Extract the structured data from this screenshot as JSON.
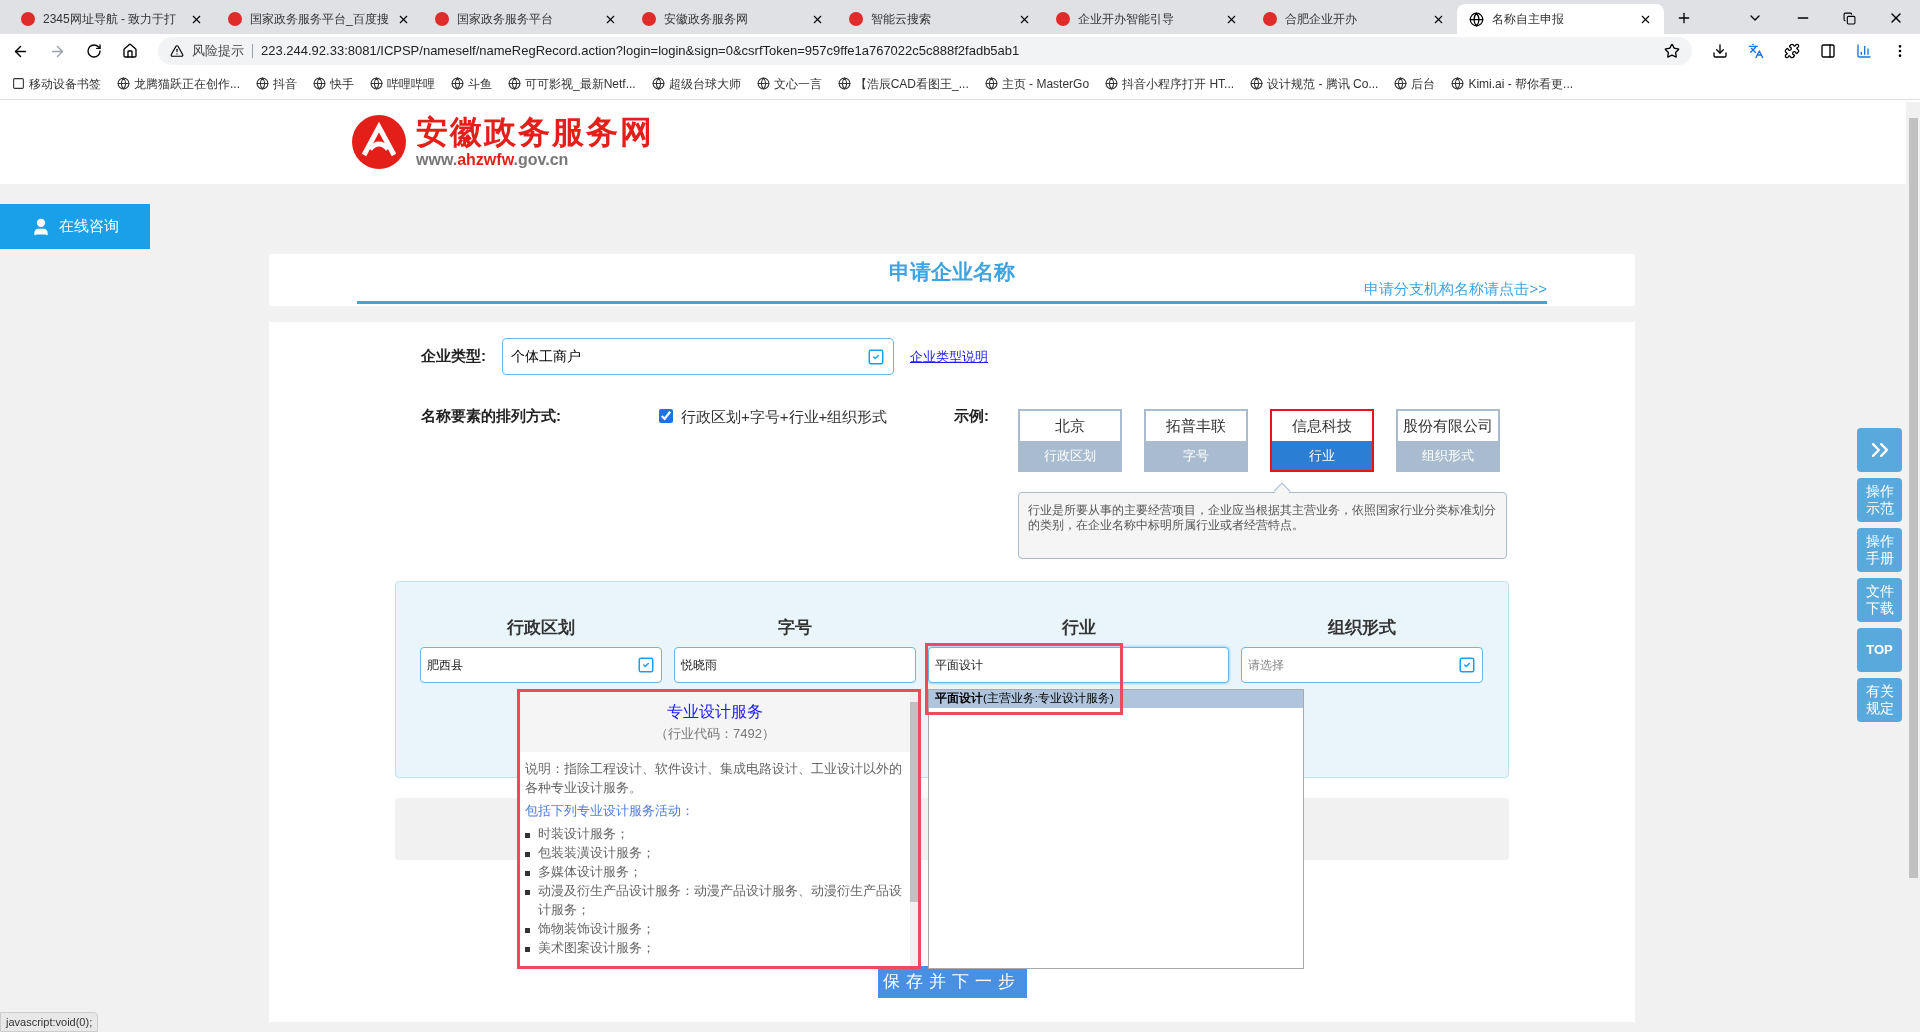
{
  "browser": {
    "tabs": [
      {
        "title": "2345网址导航 - 致力于打",
        "selected": false
      },
      {
        "title": "国家政务服务平台_百度搜",
        "selected": false
      },
      {
        "title": "国家政务服务平台",
        "selected": false
      },
      {
        "title": "安徽政务服务网",
        "selected": false
      },
      {
        "title": "智能云搜索",
        "selected": false
      },
      {
        "title": "企业开办智能引导",
        "selected": false
      },
      {
        "title": "合肥企业开办",
        "selected": false
      },
      {
        "title": "名称自主申报",
        "selected": true
      }
    ],
    "address": {
      "warning": "风险提示",
      "url": "223.244.92.33:8081/ICPSP/nameself/nameRegRecord.action?login=login&sign=0&csrfToken=957c9ffe1a767022c5c888f2fadb5ab1"
    },
    "bookmarks": [
      {
        "label": "移动设备书签"
      },
      {
        "label": "龙腾猫跃正在创作..."
      },
      {
        "label": "抖音"
      },
      {
        "label": "快手"
      },
      {
        "label": "哔哩哔哩"
      },
      {
        "label": "斗鱼"
      },
      {
        "label": "可可影视_最新Netf..."
      },
      {
        "label": "超级台球大师"
      },
      {
        "label": "文心一言"
      },
      {
        "label": "【浩辰CAD看图王_..."
      },
      {
        "label": "主页 - MasterGo"
      },
      {
        "label": "抖音小程序打开 HT..."
      },
      {
        "label": "设计规范 - 腾讯 Co..."
      },
      {
        "label": "后台"
      },
      {
        "label": "Kimi.ai - 帮你看更..."
      }
    ]
  },
  "site": {
    "logo_title": "安徽政务服务网",
    "domain_parts": [
      "www.",
      "ahzwfw",
      ".gov.cn"
    ],
    "consult_button": "在线咨询",
    "side_buttons": [
      {
        "kind": "icon"
      },
      {
        "kind": "text",
        "label": "操作示范"
      },
      {
        "kind": "text",
        "label": "操作手册"
      },
      {
        "kind": "text",
        "label": "文件下载"
      },
      {
        "kind": "bold",
        "label": "TOP"
      },
      {
        "kind": "text",
        "label": "有关规定"
      }
    ]
  },
  "form": {
    "title": "申请企业名称",
    "branch_link": "申请分支机构名称请点击>>",
    "enterprise_type": {
      "label": "企业类型:",
      "value": "个体工商户",
      "help_link": "企业类型说明"
    },
    "arrangement": {
      "label": "名称要素的排列方式:",
      "checked": true,
      "option": "行政区划+字号+行业+组织形式"
    },
    "example": {
      "label": "示例:",
      "items": [
        {
          "word": "北京",
          "part": "行政区划",
          "selected": false
        },
        {
          "word": "拓普丰联",
          "part": "字号",
          "selected": false
        },
        {
          "word": "信息科技",
          "part": "行业",
          "selected": true
        },
        {
          "word": "股份有限公司",
          "part": "组织形式",
          "selected": false
        }
      ],
      "tooltip": "行业是所要从事的主要经营项目，企业应当根据其主营业务，依照国家行业分类标准划分的类别，在企业名称中标明所属行业或者经营特点。"
    },
    "name_parts": [
      {
        "heading": "行政区划",
        "value": "肥西县",
        "picker": true
      },
      {
        "heading": "字号",
        "value": "悦晓雨",
        "picker": false
      },
      {
        "heading": "行业",
        "value": "平面设计",
        "picker": false
      },
      {
        "heading": "组织形式",
        "placeholder": "请选择",
        "picker": true
      }
    ],
    "industry_info": {
      "title": "专业设计服务",
      "code": "（行业代码：7492）",
      "description": "说明：指除工程设计、软件设计、集成电路设计、工业设计以外的各种专业设计服务。",
      "includes": "包括下列专业设计服务活动：",
      "items": [
        "时装设计服务；",
        "包装装潢设计服务；",
        "多媒体设计服务；",
        "动漫及衍生产品设计服务：动漫产品设计服务、动漫衍生产品设计服务；",
        "饰物装饰设计服务；",
        "美术图案设计服务；"
      ]
    },
    "suggestions": [
      {
        "text": "**平面设计**(主营业务:专业设计服务)",
        "selected": true
      }
    ],
    "save_button": "保存并下一步"
  },
  "status_bar": "javascript:void(0);"
}
